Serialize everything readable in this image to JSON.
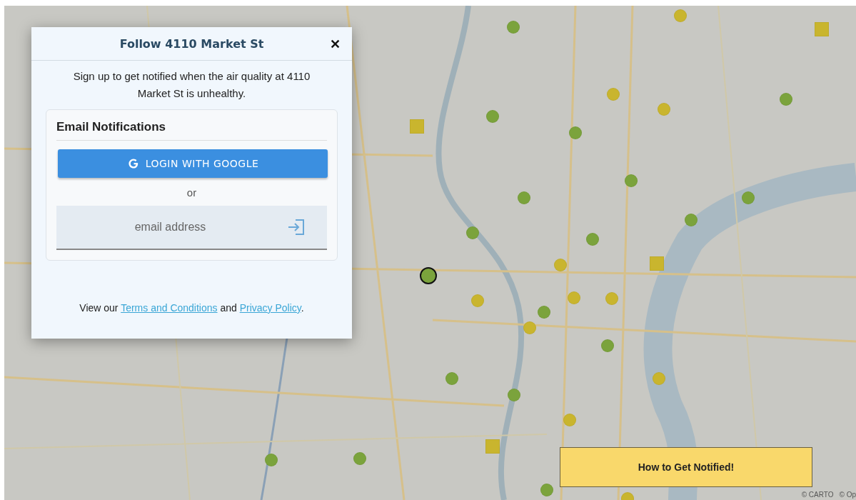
{
  "dialog": {
    "title": "Follow 4110 Market St",
    "close": "✕",
    "intro": "Sign up to get notified when the air quality at 4110 Market St is unhealthy.",
    "section_title": "Email Notifications",
    "google_button": "LOGIN WITH GOOGLE",
    "separator": "or",
    "email": {
      "placeholder": "email address"
    },
    "footer": {
      "before": "View our ",
      "terms": "Terms and Conditions",
      "middle": " and ",
      "privacy": "Privacy Policy",
      "after": "."
    }
  },
  "markers": [
    {
      "kind": "circle",
      "color": "#7ba33c",
      "selected": false
    },
    {
      "kind": "circle",
      "color": "#7ba33c",
      "selected": false
    },
    {
      "kind": "circle",
      "color": "#7ba33c",
      "selected": false
    },
    {
      "kind": "circle",
      "color": "#7ba33c",
      "selected": false
    },
    {
      "kind": "circle",
      "color": "#7ba33c",
      "selected": false
    },
    {
      "kind": "circle",
      "color": "#7ba33c",
      "selected": false
    },
    {
      "kind": "circle",
      "color": "#7ba33c",
      "selected": false
    },
    {
      "kind": "circle",
      "color": "#7ba33c",
      "selected": false
    },
    {
      "kind": "circle",
      "color": "#7ba33c",
      "selected": false
    },
    {
      "kind": "circle",
      "color": "#7ba33c",
      "selected": false
    },
    {
      "kind": "circle",
      "color": "#7ba33c",
      "selected": false
    },
    {
      "kind": "circle",
      "color": "#7ba33c",
      "selected": false
    },
    {
      "kind": "circle",
      "color": "#7ba33c",
      "selected": false
    },
    {
      "kind": "circle",
      "color": "#7ba33c",
      "selected": false
    },
    {
      "kind": "circle",
      "color": "#7ba33c",
      "selected": false
    },
    {
      "kind": "circle",
      "color": "#7ba33c",
      "selected": false
    },
    {
      "kind": "circle",
      "color": "#7ba33c",
      "selected": false
    },
    {
      "kind": "circle",
      "color": "#c9b52e",
      "selected": false
    },
    {
      "kind": "circle",
      "color": "#c9b52e",
      "selected": false
    },
    {
      "kind": "circle",
      "color": "#c9b52e",
      "selected": false
    },
    {
      "kind": "circle",
      "color": "#c9b52e",
      "selected": false
    },
    {
      "kind": "circle",
      "color": "#c9b52e",
      "selected": false
    },
    {
      "kind": "circle",
      "color": "#c9b52e",
      "selected": false
    },
    {
      "kind": "circle",
      "color": "#c9b52e",
      "selected": false
    },
    {
      "kind": "circle",
      "color": "#c9b52e",
      "selected": false
    },
    {
      "kind": "circle",
      "color": "#c9b52e",
      "selected": false
    },
    {
      "kind": "circle",
      "color": "#c9b52e",
      "selected": false
    },
    {
      "kind": "circle",
      "color": "#c9b52e",
      "selected": false
    },
    {
      "kind": "square",
      "color": "#c9b52e",
      "selected": false
    },
    {
      "kind": "square",
      "color": "#c9b52e",
      "selected": false
    },
    {
      "kind": "square",
      "color": "#c9b52e",
      "selected": false
    },
    {
      "kind": "square",
      "color": "#c9b52e",
      "selected": false
    },
    {
      "kind": "circle",
      "color": "#7ba33c",
      "selected": true
    }
  ],
  "help_button": "How to Get Notified!",
  "attribution": [
    "© CARTO",
    "© Op"
  ]
}
